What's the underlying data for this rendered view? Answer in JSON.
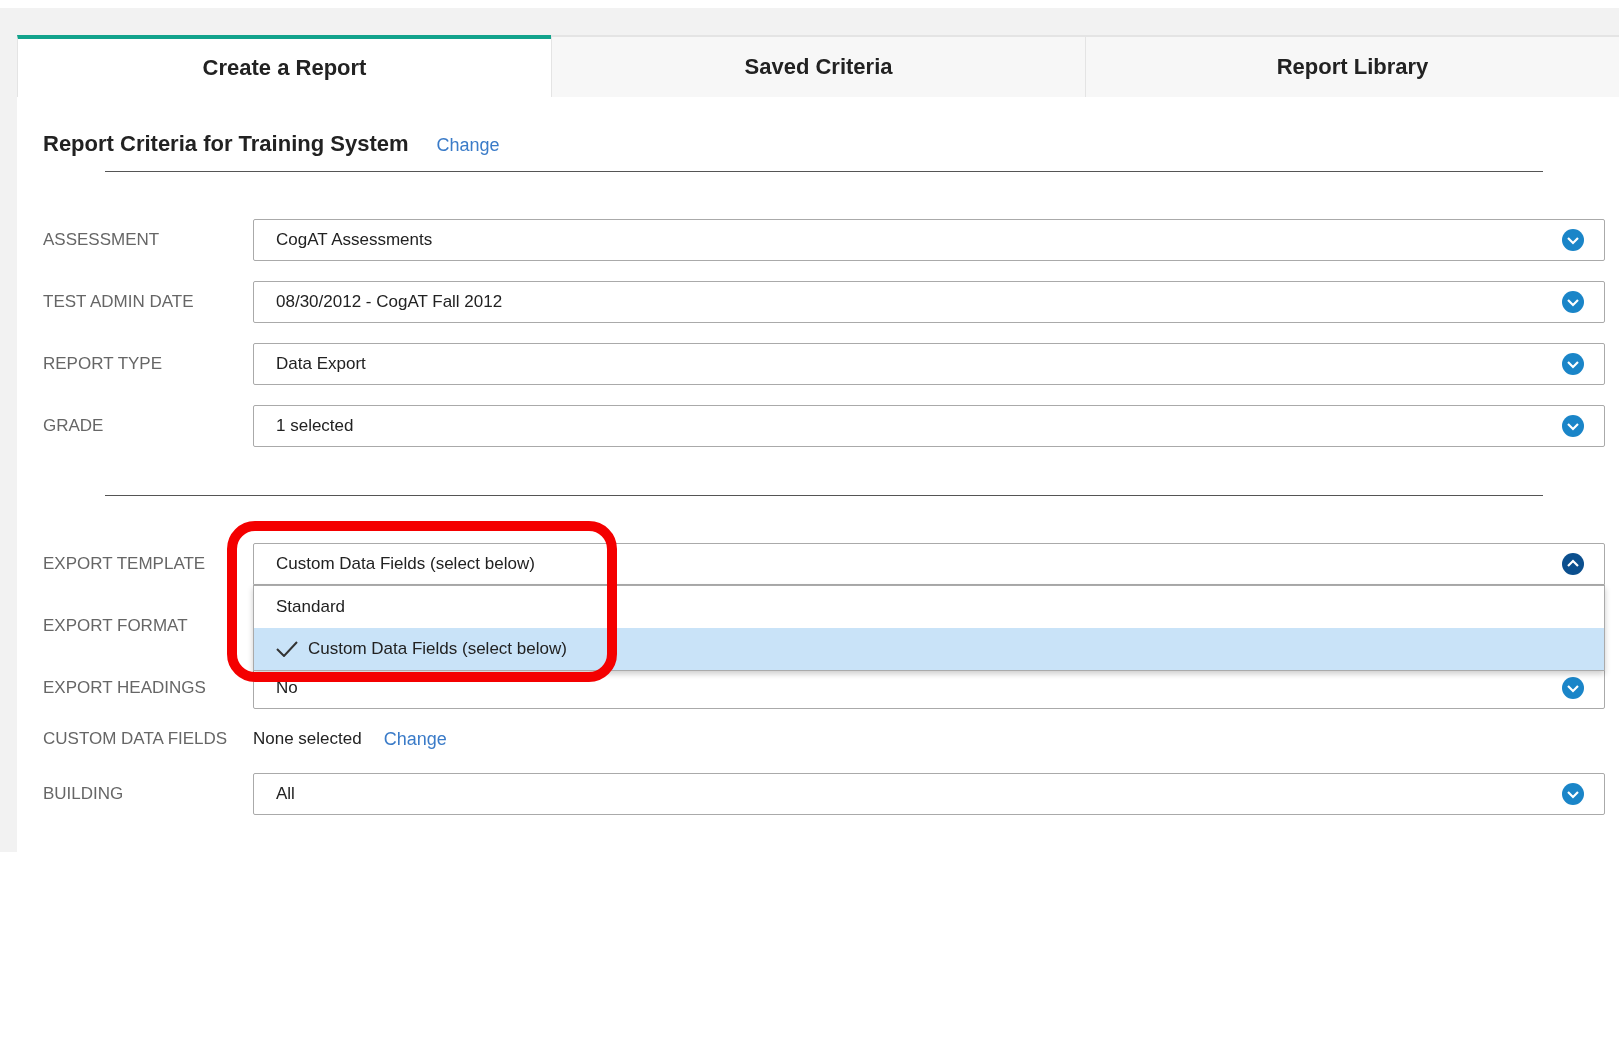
{
  "tabs": [
    {
      "label": "Create a Report",
      "selected": true
    },
    {
      "label": "Saved Criteria",
      "selected": false
    },
    {
      "label": "Report Library",
      "selected": false
    }
  ],
  "heading": {
    "title": "Report Criteria for Training System",
    "link": "Change"
  },
  "sections": [
    {
      "fields": [
        {
          "kind": "select",
          "label": "ASSESSMENT",
          "value": "CogAT Assessments",
          "expanded": false
        },
        {
          "kind": "select",
          "label": "TEST ADMIN DATE",
          "value": "08/30/2012 - CogAT Fall 2012",
          "expanded": false
        },
        {
          "kind": "select",
          "label": "REPORT TYPE",
          "value": "Data Export",
          "expanded": false
        },
        {
          "kind": "select",
          "label": "GRADE",
          "value": "1 selected",
          "expanded": false
        }
      ]
    },
    {
      "fields": [
        {
          "kind": "select",
          "label": "EXPORT TEMPLATE",
          "value": "Custom Data Fields (select below)",
          "expanded": true,
          "options": [
            {
              "label": "Standard",
              "selected": false
            },
            {
              "label": "Custom Data Fields (select below)",
              "selected": true
            }
          ]
        },
        {
          "kind": "hidden",
          "label": "EXPORT FORMAT"
        },
        {
          "kind": "select",
          "label": "EXPORT HEADINGS",
          "value": "No",
          "expanded": false
        },
        {
          "kind": "text_link",
          "label": "CUSTOM DATA FIELDS",
          "value": "None selected",
          "link": "Change"
        },
        {
          "kind": "select",
          "label": "BUILDING",
          "value": "All",
          "expanded": false
        }
      ]
    }
  ]
}
